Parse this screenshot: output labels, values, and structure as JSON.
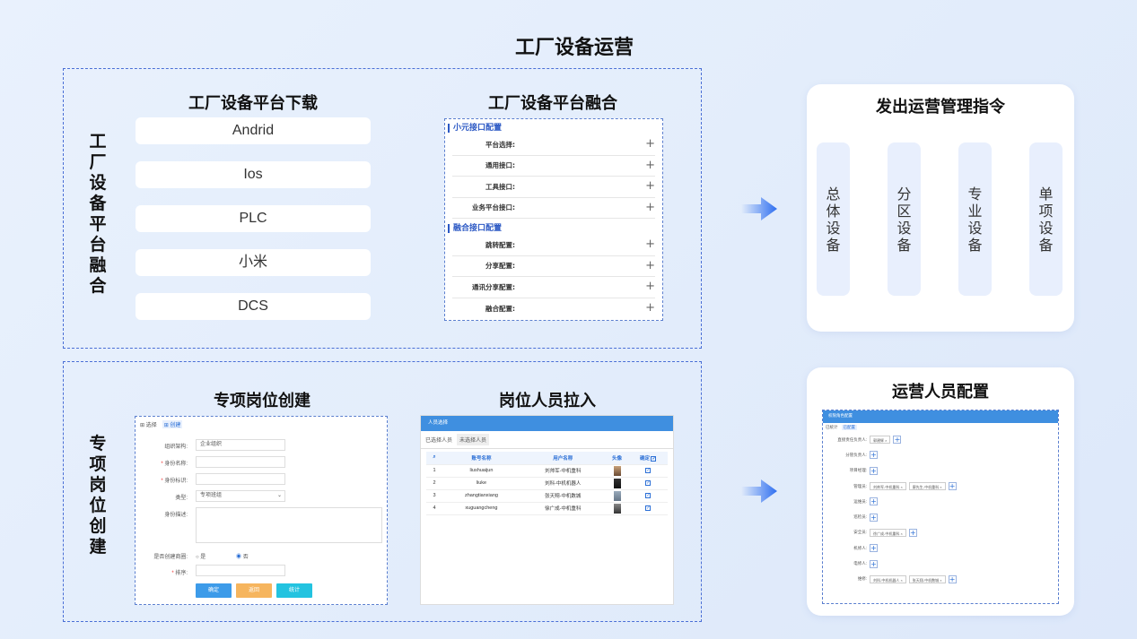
{
  "main_title": "工厂设备运营",
  "top": {
    "side_label": "工厂设备平台融合",
    "download": {
      "title": "工厂设备平台下载",
      "items": [
        "Andrid",
        "Ios",
        "PLC",
        "小米",
        "DCS"
      ]
    },
    "fusion": {
      "title": "工厂设备平台融合",
      "section1": "小元接口配置",
      "rows1": [
        "平台选择:",
        "通用接口:",
        "工具接口:",
        "业务平台接口:"
      ],
      "section2": "融合接口配置",
      "rows2": [
        "跳转配置:",
        "分享配置:",
        "通讯分享配置:",
        "融合配置:"
      ],
      "plus_glyph": "+"
    }
  },
  "right_top": {
    "title": "发出运营管理指令",
    "columns": [
      "总体设备",
      "分区设备",
      "专业设备",
      "单项设备"
    ]
  },
  "bottom": {
    "side_label": "专项岗位创建",
    "create": {
      "title": "专项岗位创建",
      "tab1": "选择",
      "tab2": "创建",
      "fields": {
        "org_label": "组织架构:",
        "org_value": "企业组织",
        "name_label": "身份名称:",
        "id_label": "身份标识:",
        "type_label": "类型:",
        "type_value": "专项班组",
        "desc_label": "身份描述:",
        "perm_label": "是否创建商圈:",
        "opt_yes": "是",
        "opt_no": "否",
        "sort_label": "排序:"
      },
      "buttons": [
        "确定",
        "返回",
        "统计"
      ]
    },
    "pull": {
      "title": "岗位人员拉入",
      "header": "人员选择",
      "tab1": "已选择人员",
      "tab2": "未选择人员",
      "columns": [
        "账号名称",
        "用户名称",
        "头像",
        "确定"
      ],
      "rows": [
        [
          "1",
          "liushuaijun",
          "刘帅军-中机重科"
        ],
        [
          "2",
          "liuke",
          "刘科-中机机器人"
        ],
        [
          "3",
          "zhangtianxiang",
          "张天翔-中机数城"
        ],
        [
          "4",
          "xuguangcheng",
          "徐广成-中机重科"
        ]
      ]
    }
  },
  "right_bottom": {
    "title": "运营人员配置",
    "header": "权限角色配置",
    "tab1": "已统计",
    "tab2": "已配置",
    "rows": [
      {
        "label": "直接责任负责人:",
        "tags": [
          "郭建辉"
        ]
      },
      {
        "label": "分管负责人:",
        "tags": []
      },
      {
        "label": "项目经理:",
        "tags": []
      },
      {
        "label": "管理员:",
        "tags": [
          "刘帅军-中机重科",
          "廖先生-中机重科"
        ]
      },
      {
        "label": "运维员:",
        "tags": []
      },
      {
        "label": "巡检员:",
        "tags": []
      },
      {
        "label": "安全员:",
        "tags": [
          "徐广成-中机重科"
        ]
      },
      {
        "label": "机修人:",
        "tags": []
      },
      {
        "label": "电修人:",
        "tags": []
      },
      {
        "label": "维修:",
        "tags": [
          "刘科-中机机器人",
          "张天翔-中机数城"
        ]
      }
    ]
  },
  "colors": {
    "accent": "#2b6fd6",
    "dash": "#4a6fd6",
    "arrow": "#2f6ff0"
  }
}
